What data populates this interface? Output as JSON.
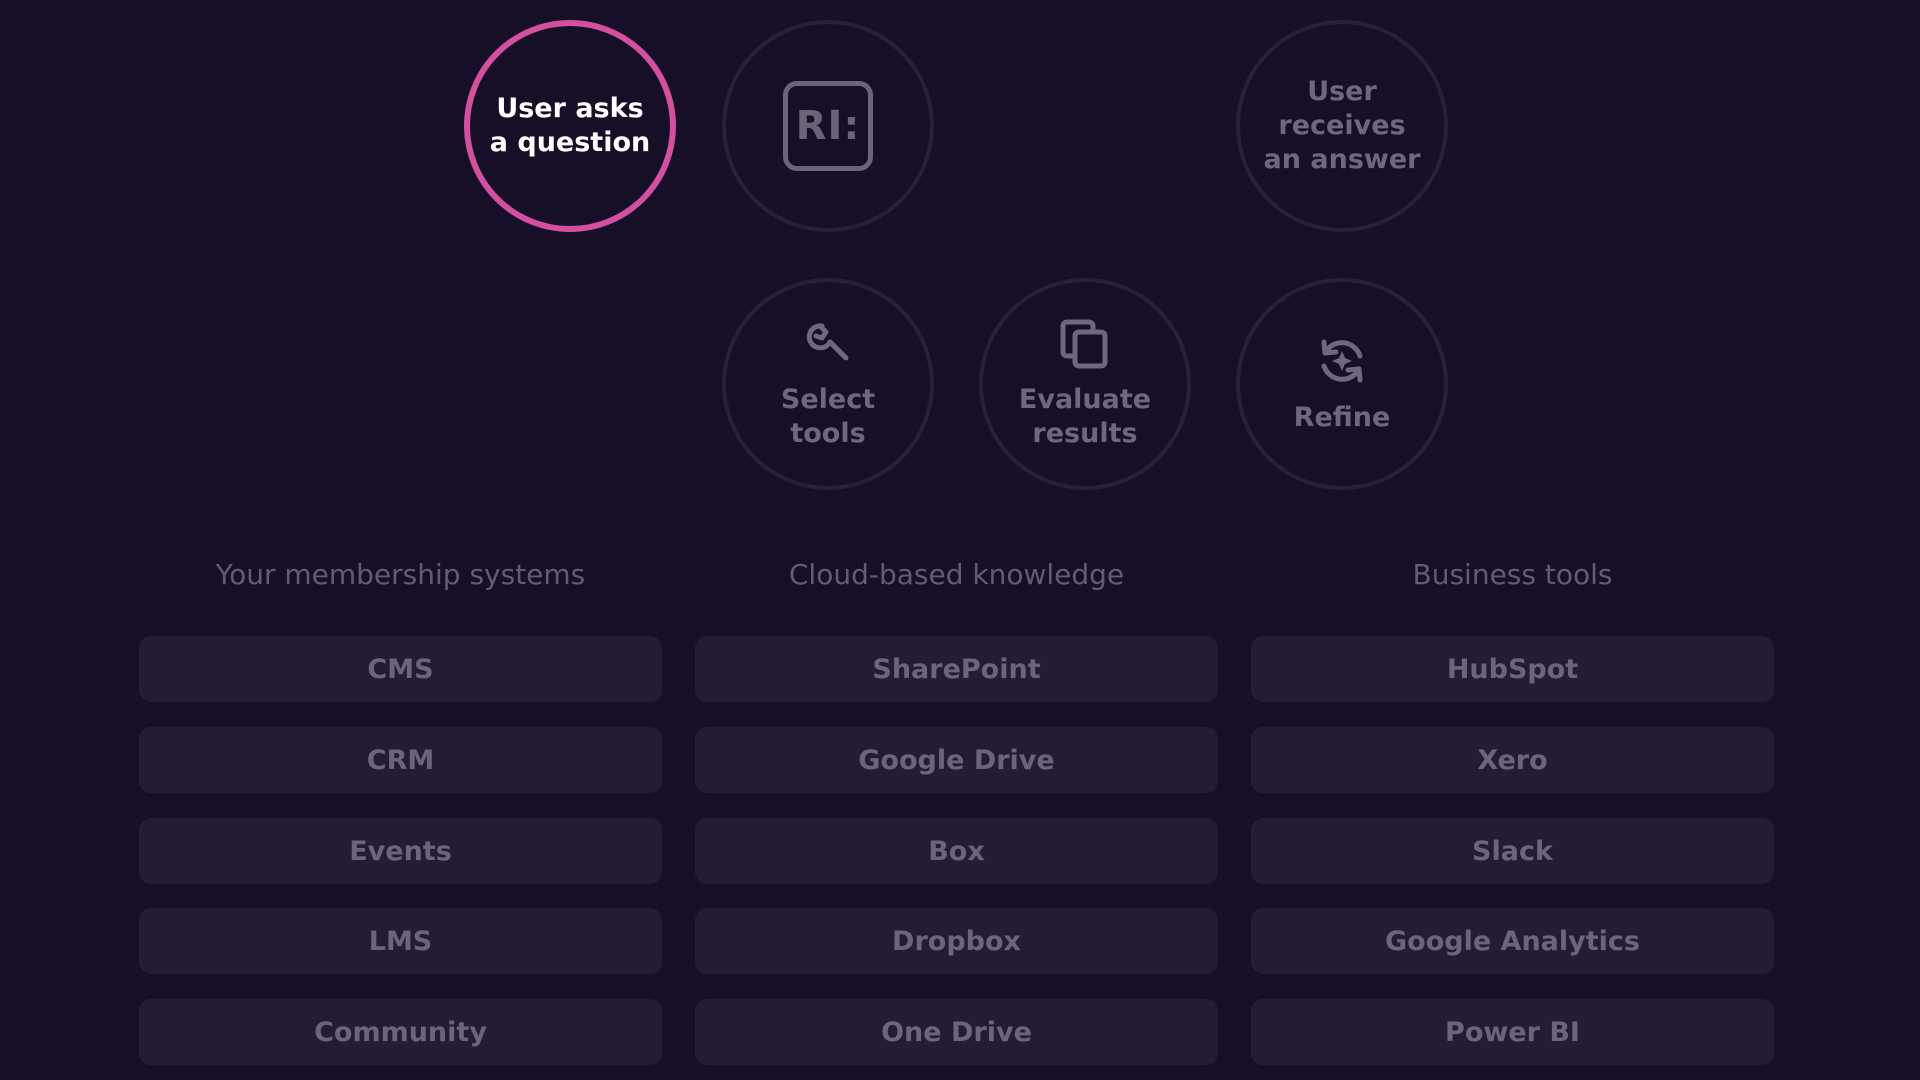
{
  "flow": {
    "ask": "User asks\na question",
    "logo": "RI:",
    "answer": "User\nreceives\nan answer",
    "select_tools": "Select\ntools",
    "evaluate": "Evaluate\nresults",
    "refine": "Refine"
  },
  "columns": [
    {
      "header": "Your membership systems",
      "items": [
        "CMS",
        "CRM",
        "Events",
        "LMS",
        "Community"
      ]
    },
    {
      "header": "Cloud-based knowledge",
      "items": [
        "SharePoint",
        "Google Drive",
        "Box",
        "Dropbox",
        "One Drive"
      ]
    },
    {
      "header": "Business tools",
      "items": [
        "HubSpot",
        "Xero",
        "Slack",
        "Google Analytics",
        "Power BI"
      ]
    }
  ],
  "colors": {
    "background": "#170f27",
    "accent": "#d2509f",
    "ring": "#272038",
    "pill": "#241c33"
  }
}
